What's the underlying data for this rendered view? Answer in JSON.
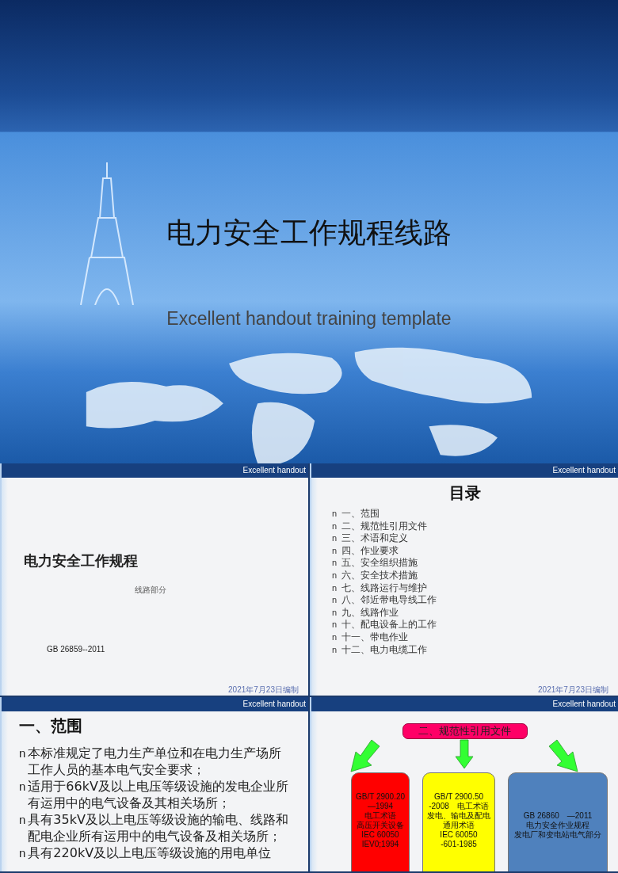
{
  "cover": {
    "title": "电力安全工作规程线路",
    "subtitle": "Excellent handout training template"
  },
  "slides": [
    {
      "kind": "title",
      "header": "Excellent handout",
      "title": "电力安全工作规程",
      "subtitle": "线路部分",
      "code": "GB  26859--2011",
      "date": "2021年7月23日编制"
    },
    {
      "kind": "contents",
      "header": "Excellent handout",
      "title": "目录",
      "date": "2021年7月23日编制",
      "items": [
        {
          "bullet": "n",
          "text": "一、范围"
        },
        {
          "bullet": "n",
          "text": "二、规范性引用文件"
        },
        {
          "bullet": "n",
          "text": "三、术语和定义"
        },
        {
          "bullet": "n",
          "text": "四、作业要求"
        },
        {
          "bullet": "n",
          "text": "五、安全组织措施"
        },
        {
          "bullet": "n",
          "text": "六、安全技术措施"
        },
        {
          "bullet": "n",
          "text": "七、线路运行与维护"
        },
        {
          "bullet": "n",
          "text": "八、邻近带电导线工作"
        },
        {
          "bullet": "n",
          "text": "九、线路作业"
        },
        {
          "bullet": "n",
          "text": "十、配电设备上的工作"
        },
        {
          "bullet": "n",
          "text": "十一、带电作业"
        },
        {
          "bullet": "n",
          "text": "十二、电力电缆工作"
        }
      ]
    },
    {
      "kind": "bullets",
      "header": "Excellent handout",
      "title": "一、范围",
      "items": [
        {
          "bullet": "n",
          "text": "本标准规定了电力生产单位和在电力生产场所工作人员的基本电气安全要求；"
        },
        {
          "bullet": "n",
          "text": "适用于66kV及以上电压等级设施的发电企业所有运用中的电气设备及其相关场所；"
        },
        {
          "bullet": "n",
          "text": "具有35kV及以上电压等级设施的输电、线路和配电企业所有运用中的电气设备及相关场所；"
        },
        {
          "bullet": "n",
          "text": "具有220kV及以上电压等级设施的用电单位"
        }
      ]
    },
    {
      "kind": "diagram",
      "header": "Excellent handout",
      "title": "二、规范性引用文件",
      "boxes": [
        {
          "color": "#ff0000",
          "lines": [
            "GB/T 2900.20",
            "—1994",
            "电工术语",
            "高压开关设备",
            "IEC 60050",
            "IEV0;1994"
          ]
        },
        {
          "color": "#ffff00",
          "lines": [
            "GB/T 2900.50",
            "-2008　电工术语",
            "发电、输电及配电",
            "通用术语",
            "IEC 60050",
            "-601-1985"
          ]
        },
        {
          "color": "#4f81bd",
          "lines": [
            "GB 26860　—2011",
            "电力安全作业规程",
            "发电厂和变电站电气部分"
          ]
        }
      ]
    }
  ]
}
